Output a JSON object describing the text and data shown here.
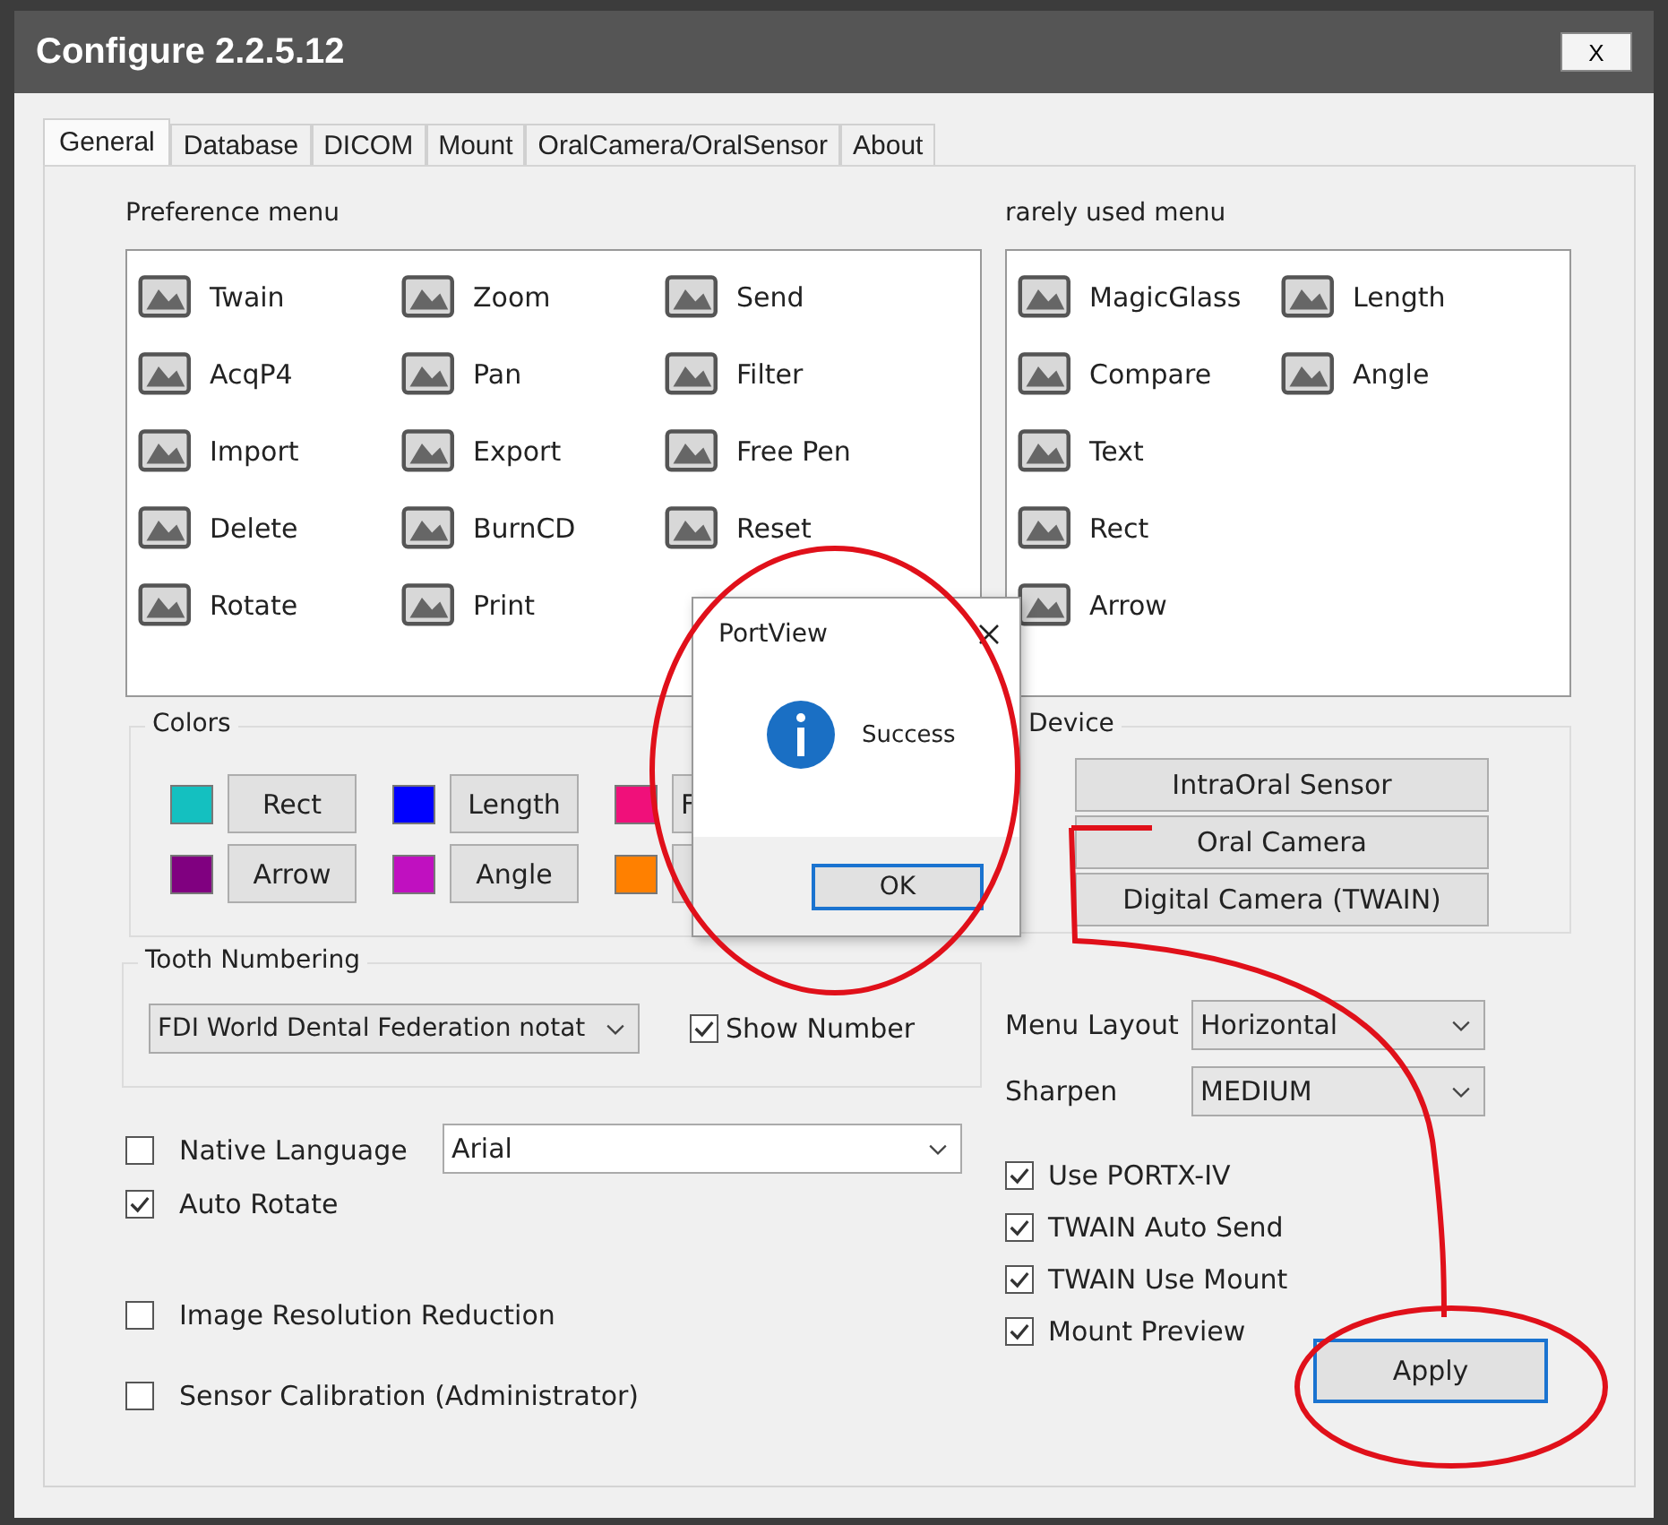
{
  "window": {
    "title": "Configure 2.2.5.12",
    "close": "X"
  },
  "tabs": [
    {
      "label": "General",
      "selected": true
    },
    {
      "label": "Database",
      "selected": false
    },
    {
      "label": "DICOM",
      "selected": false
    },
    {
      "label": "Mount",
      "selected": false
    },
    {
      "label": "OralCamera/OralSensor",
      "selected": false
    },
    {
      "label": "About",
      "selected": false
    }
  ],
  "preference_menu": {
    "title": "Preference menu",
    "items": [
      "Twain",
      "Zoom",
      "Send",
      "AcqP4",
      "Pan",
      "Filter",
      "Import",
      "Export",
      "Free Pen",
      "Delete",
      "BurnCD",
      "Reset",
      "Rotate",
      "Print"
    ]
  },
  "rarely_used_menu": {
    "title": "rarely used menu",
    "columns": [
      [
        "MagicGlass",
        "Compare",
        "Text",
        "Rect",
        "Arrow"
      ],
      [
        "Length",
        "Angle"
      ]
    ]
  },
  "colors": {
    "title": "Colors",
    "items": [
      {
        "color": "#14c0c0",
        "label": "Rect"
      },
      {
        "color": "#0000ff",
        "label": "Length"
      },
      {
        "color": "#f0107a",
        "label": "F"
      },
      {
        "color": "#800080",
        "label": "Arrow"
      },
      {
        "color": "#c010c0",
        "label": "Angle"
      },
      {
        "color": "#ff8000"
      }
    ]
  },
  "device": {
    "title": "Device",
    "buttons": [
      "IntraOral Sensor",
      "Oral Camera",
      "Digital Camera (TWAIN)"
    ]
  },
  "tooth_numbering": {
    "title": "Tooth Numbering",
    "value": "FDI World Dental Federation notat",
    "show_number": {
      "label": "Show Number",
      "checked": true
    }
  },
  "font_select": {
    "value": "Arial"
  },
  "left_options": [
    {
      "label": "Native Language",
      "checked": false
    },
    {
      "label": "Auto Rotate",
      "checked": true
    },
    {
      "label": "Image Resolution Reduction",
      "checked": false
    },
    {
      "label": "Sensor Calibration (Administrator)",
      "checked": false
    }
  ],
  "menu_layout": {
    "label": "Menu Layout",
    "value": "Horizontal"
  },
  "sharpen": {
    "label": "Sharpen",
    "value": "MEDIUM"
  },
  "right_options": [
    {
      "label": "Use PORTX-IV",
      "checked": true
    },
    {
      "label": "TWAIN Auto Send",
      "checked": true
    },
    {
      "label": "TWAIN Use Mount",
      "checked": true
    },
    {
      "label": "Mount Preview",
      "checked": true
    }
  ],
  "apply": "Apply",
  "dialog": {
    "title": "PortView",
    "message": "Success",
    "ok": "OK"
  }
}
